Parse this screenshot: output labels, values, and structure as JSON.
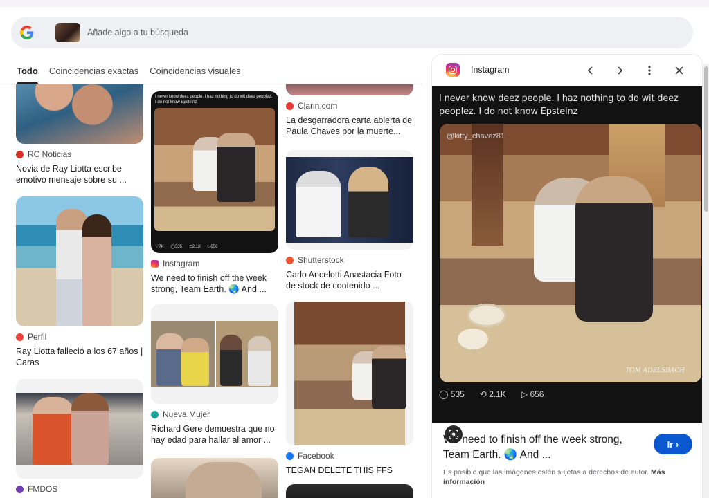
{
  "search": {
    "placeholder": "Añade algo a tu búsqueda"
  },
  "tabs": [
    {
      "label": "Todo",
      "active": true
    },
    {
      "label": "Coincidencias exactas",
      "active": false
    },
    {
      "label": "Coincidencias visuales",
      "active": false
    }
  ],
  "results": {
    "col1": [
      {
        "source": "RC Noticias",
        "title": "Novia de Ray Liotta escribe emotivo mensaje sobre su ...",
        "favicon_color": "#d93025"
      },
      {
        "source": "Perfil",
        "title": "Ray Liotta falleció a los 67 años | Caras",
        "favicon_color": "#e8453c"
      },
      {
        "source": "FMDOS",
        "title": "",
        "favicon_color": "#6f3fb0"
      }
    ],
    "col2": [
      {
        "source": "Instagram",
        "title": "We need to finish off the week strong, Team Earth. 🌏 And ...",
        "favicon_color": "#d62976",
        "thumb_caption": "I never know deez people. I haz nothing to do wit deez peoplez. I do not know Epsteinz",
        "thumb_stats": "♡7K ◯535 ⟲2.1K ▷656"
      },
      {
        "source": "Nueva Mujer",
        "title": "Richard Gere demuestra que no hay edad para hallar al amor ...",
        "favicon_color": "#1aa39a"
      }
    ],
    "col3": [
      {
        "source": "Clarin.com",
        "title": "La desgarradora carta abierta de Paula Chaves por la muerte...",
        "favicon_color": "#e53935"
      },
      {
        "source": "Shutterstock",
        "title": "Carlo Ancelotti Anastacia Foto de stock de contenido ...",
        "favicon_color": "#f0522d"
      },
      {
        "source": "Facebook",
        "title": "TEGAN DELETE THIS FFS",
        "favicon_color": "#1877f2"
      }
    ]
  },
  "panel": {
    "source": "Instagram",
    "caption": "I never know deez people. I haz nothing to do wit deez peoplez. I do not know Epsteinz",
    "handle": "@kitty_chavez81",
    "watermark": "TOM ADELSBACH",
    "stats": {
      "comments": "535",
      "reposts": "2.1K",
      "shares": "656"
    },
    "title": "We need to finish off the week strong, Team Earth. 🌏 And ...",
    "go_label": "Ir",
    "note": "Es posible que las imágenes estén sujetas a derechos de autor.",
    "note_more": "Más información"
  },
  "colors": {
    "accent": "#0b57d0",
    "searchbar_bg": "#eef0f3"
  }
}
